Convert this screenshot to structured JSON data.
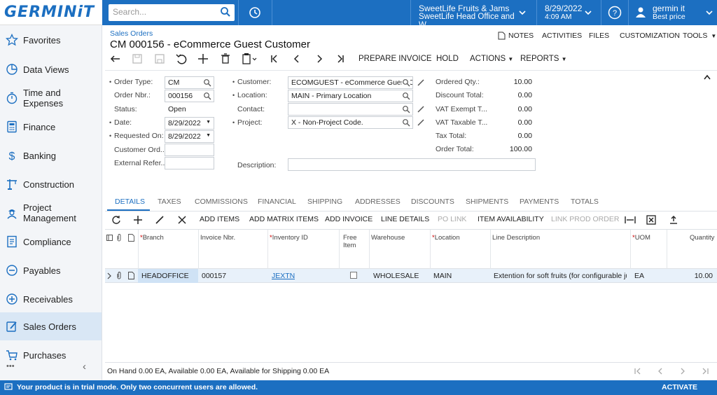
{
  "app": {
    "logo_text": "GERMINiT"
  },
  "topbar": {
    "search_placeholder": "Search...",
    "company_line1": "SweetLife Fruits & Jams",
    "company_line2": "SweetLife Head Office and W...",
    "date": "8/29/2022",
    "time": "4:09 AM",
    "user_name": "germin it",
    "user_role": "Best price"
  },
  "sidebar": {
    "items": [
      {
        "label": "Favorites",
        "icon": "star-icon"
      },
      {
        "label": "Data Views",
        "icon": "pie-chart-icon"
      },
      {
        "label": "Time and Expenses",
        "icon": "stopwatch-icon"
      },
      {
        "label": "Finance",
        "icon": "calculator-icon"
      },
      {
        "label": "Banking",
        "icon": "dollar-icon"
      },
      {
        "label": "Construction",
        "icon": "crane-icon"
      },
      {
        "label": "Project Management",
        "icon": "worker-icon"
      },
      {
        "label": "Compliance",
        "icon": "checklist-icon"
      },
      {
        "label": "Payables",
        "icon": "minus-circle-icon"
      },
      {
        "label": "Receivables",
        "icon": "plus-circle-icon"
      },
      {
        "label": "Sales Orders",
        "icon": "pencil-square-icon"
      },
      {
        "label": "Purchases",
        "icon": "cart-icon"
      }
    ],
    "more": "•••",
    "collapse": "‹"
  },
  "page": {
    "breadcrumb": "Sales Orders",
    "title": "CM 000156 - eCommerce Guest Customer",
    "actions": {
      "notes": "NOTES",
      "activities": "ACTIVITIES",
      "files": "FILES",
      "customization": "CUSTOMIZATION",
      "tools": "TOOLS"
    }
  },
  "toolbar": {
    "prepare_invoice": "PREPARE INVOICE",
    "hold": "HOLD",
    "actions": "ACTIONS",
    "reports": "REPORTS"
  },
  "form": {
    "order_type_label": "Order Type:",
    "order_type": "CM",
    "order_nbr_label": "Order Nbr.:",
    "order_nbr": "000156",
    "status_label": "Status:",
    "status": "Open",
    "date_label": "Date:",
    "date": "8/29/2022",
    "requested_label": "Requested On:",
    "requested": "8/29/2022",
    "customer_ord_label": "Customer Ord...",
    "external_ref_label": "External Refer...",
    "customer_label": "Customer:",
    "customer": "ECOMGUEST - eCommerce Guest Cu",
    "location_label": "Location:",
    "location": "MAIN - Primary Location",
    "contact_label": "Contact:",
    "project_label": "Project:",
    "project": "X - Non-Project Code.",
    "description_label": "Description:",
    "ordered_qty_label": "Ordered Qty.:",
    "ordered_qty": "10.00",
    "discount_total_label": "Discount Total:",
    "discount_total": "0.00",
    "vat_exempt_label": "VAT Exempt T...",
    "vat_exempt": "0.00",
    "vat_taxable_label": "VAT Taxable T...",
    "vat_taxable": "0.00",
    "tax_total_label": "Tax Total:",
    "tax_total": "0.00",
    "order_total_label": "Order Total:",
    "order_total": "100.00"
  },
  "tabs": [
    "DETAILS",
    "TAXES",
    "COMMISSIONS",
    "FINANCIAL",
    "SHIPPING",
    "ADDRESSES",
    "DISCOUNTS",
    "SHIPMENTS",
    "PAYMENTS",
    "TOTALS"
  ],
  "grid_toolbar": {
    "add_items": "ADD ITEMS",
    "add_matrix_items": "ADD MATRIX ITEMS",
    "add_invoice": "ADD INVOICE",
    "line_details": "LINE DETAILS",
    "po_link": "PO LINK",
    "item_availability": "ITEM AVAILABILITY",
    "link_prod_order": "LINK PROD ORDER"
  },
  "grid": {
    "headers": {
      "branch": "Branch",
      "invoice_nbr": "Invoice Nbr.",
      "inventory_id": "Inventory ID",
      "free_item_1": "Free",
      "free_item_2": "Item",
      "warehouse": "Warehouse",
      "location": "Location",
      "line_description": "Line Description",
      "uom": "UOM",
      "quantity": "Quantity"
    },
    "rows": [
      {
        "branch": "HEADOFFICE",
        "invoice_nbr": "000157",
        "inventory_id": "JEXTN",
        "warehouse": "WHOLESALE",
        "location": "MAIN",
        "line_description": "Extention for soft fruits (for configurable jui...",
        "uom": "EA",
        "quantity": "10.00"
      }
    ]
  },
  "status_bar": "On Hand 0.00 EA, Available 0.00 EA, Available for Shipping 0.00 EA",
  "trial": {
    "message": "Your product is in trial mode. Only two concurrent users are allowed.",
    "activate": "ACTIVATE"
  },
  "colors": {
    "accent": "#1c6fc1",
    "sidebar_bg": "#f3f5f8",
    "selected_row": "#e8f1fa"
  }
}
